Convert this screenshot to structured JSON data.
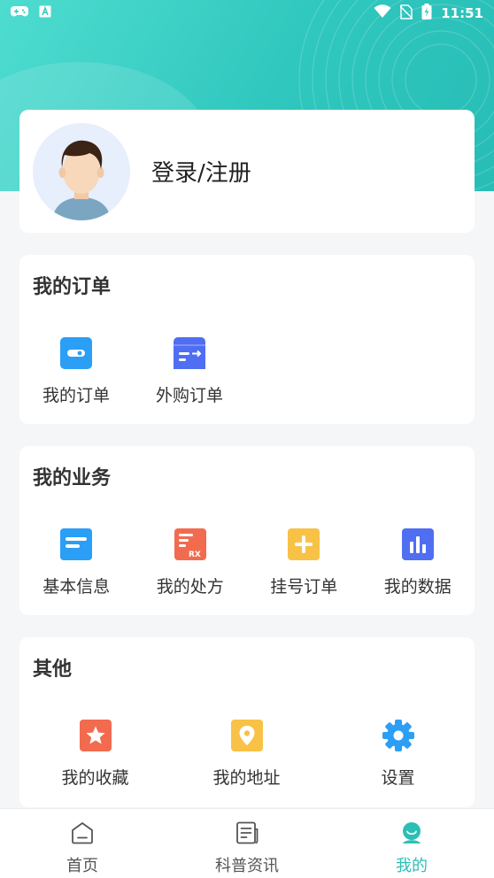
{
  "status_bar": {
    "time": "11:51"
  },
  "profile": {
    "login_label": "登录/注册"
  },
  "orders": {
    "title": "我的订单",
    "items": [
      {
        "label": "我的订单",
        "icon": "order-icon",
        "color": "#2b9ef6"
      },
      {
        "label": "外购订单",
        "icon": "external-order-icon",
        "color": "#4f6ef2"
      }
    ]
  },
  "business": {
    "title": "我的业务",
    "items": [
      {
        "label": "基本信息",
        "icon": "info-icon",
        "color": "#2b9ef6"
      },
      {
        "label": "我的处方",
        "icon": "prescription-icon",
        "color": "#f26b4f"
      },
      {
        "label": "挂号订单",
        "icon": "registration-icon",
        "color": "#f8c247"
      },
      {
        "label": "我的数据",
        "icon": "data-icon",
        "color": "#4f6ef2"
      }
    ]
  },
  "other": {
    "title": "其他",
    "items": [
      {
        "label": "我的收藏",
        "icon": "favorite-icon",
        "color": "#f26b4f"
      },
      {
        "label": "我的地址",
        "icon": "address-icon",
        "color": "#f8c247"
      },
      {
        "label": "设置",
        "icon": "settings-icon",
        "color": "#2b9ef6"
      }
    ]
  },
  "tabbar": {
    "accent": "#2bbfb6",
    "tabs": [
      {
        "label": "首页",
        "icon": "home-icon"
      },
      {
        "label": "科普资讯",
        "icon": "news-icon"
      },
      {
        "label": "我的",
        "icon": "profile-icon",
        "active": true
      }
    ]
  }
}
